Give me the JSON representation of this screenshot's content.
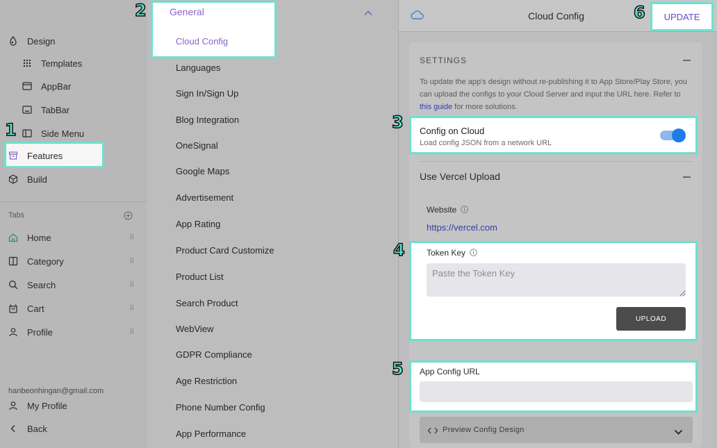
{
  "sidebar": {
    "items": [
      {
        "label": "Design"
      },
      {
        "label": "Templates"
      },
      {
        "label": "AppBar"
      },
      {
        "label": "TabBar"
      },
      {
        "label": "Side Menu"
      },
      {
        "label": "Features"
      },
      {
        "label": "Build"
      }
    ],
    "tabs_label": "Tabs",
    "tabs": [
      {
        "label": "Home"
      },
      {
        "label": "Category"
      },
      {
        "label": "Search"
      },
      {
        "label": "Cart"
      },
      {
        "label": "Profile"
      }
    ],
    "email": "hanbeonhingan@gmail.com",
    "my_profile": "My Profile",
    "back": "Back"
  },
  "features_menu": {
    "section_title": "General",
    "selected": "Cloud Config",
    "items": [
      "Languages",
      "Sign In/Sign Up",
      "Blog Integration",
      "OneSignal",
      "Google Maps",
      "Advertisement",
      "App Rating",
      "Product Card Customize",
      "Product List",
      "Search Product",
      "WebView",
      "GDPR Compliance",
      "Age Restriction",
      "Phone Number Config",
      "App Performance"
    ]
  },
  "header": {
    "title": "Cloud Config",
    "update_label": "UPDATE"
  },
  "settings": {
    "label": "SETTINGS",
    "desc_before": "To update the app's design without re-publishing it to App Store/Play Store, you can upload the configs to your Cloud Server and input the URL here. Refer to ",
    "desc_link": "this guide",
    "desc_after": " for more solutions.",
    "config_title": "Config on Cloud",
    "config_sub": "Load config JSON from a network URL",
    "config_enabled": true
  },
  "vercel": {
    "title": "Use Vercel Upload",
    "website_label": "Website",
    "website_url": "https://vercel.com",
    "token_label": "Token Key",
    "token_placeholder": "Paste the Token Key",
    "upload_label": "UPLOAD"
  },
  "app_config": {
    "label": "App Config URL",
    "value": ""
  },
  "preview": {
    "label": "Preview Config Design"
  },
  "annotations": [
    "1",
    "2",
    "3",
    "4",
    "5",
    "6"
  ],
  "colors": {
    "highlight": "#6ee0cf",
    "accent": "#8b62c9",
    "toggle": "#1e7be8",
    "link": "#3a3aa8"
  }
}
